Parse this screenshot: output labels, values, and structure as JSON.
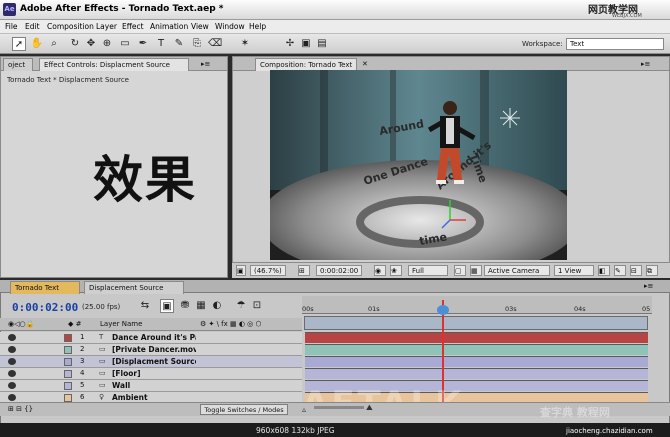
{
  "window": {
    "title": "Adobe After Effects - Tornado Text.aep *",
    "app_icon": "Ae"
  },
  "watermark_top": {
    "text": "网页教学网",
    "sub": "WEBJX.COM"
  },
  "menu": [
    "File",
    "Edit",
    "Composition",
    "Layer",
    "Effect",
    "Animation",
    "View",
    "Window",
    "Help"
  ],
  "workspace": {
    "label": "Workspace:",
    "value": "Text"
  },
  "left_panel": {
    "tabs": [
      "oject",
      "Effect Controls: Displacment Source"
    ],
    "subtitle": "Tornado Text * Displacment Source",
    "overlay_text": "效果"
  },
  "comp_panel": {
    "tab": "Composition: Tornado Text",
    "footer": {
      "zoom": "(46.7%)",
      "timecode": "0:00:02:00",
      "resolution": "Full",
      "camera": "Active Camera",
      "views": "1 View"
    }
  },
  "timeline": {
    "tabs": [
      "Tornado Text",
      "Displacement Source"
    ],
    "timecode": "0:00:02:00",
    "fps": "(25.00 fps)",
    "ruler": [
      "00s",
      "01s",
      "03s",
      "04s",
      "05"
    ],
    "layer_header": "Layer Name",
    "layers": [
      {
        "num": "1",
        "type": "T",
        "name": "Dance Around it's Pa",
        "color": "#b84343"
      },
      {
        "num": "2",
        "type": "▭",
        "name": "[Private Dancer.mov",
        "color": "#8fc3b8"
      },
      {
        "num": "3",
        "type": "▭",
        "name": "[Displacment Source",
        "color": "#a9a9d6"
      },
      {
        "num": "4",
        "type": "▭",
        "name": "[Floor]",
        "color": "#b5b5d8"
      },
      {
        "num": "5",
        "type": "▭",
        "name": "Wall",
        "color": "#b5b5d8"
      },
      {
        "num": "6",
        "type": "♀",
        "name": "Ambient",
        "color": "#e8c49c"
      }
    ],
    "toggle_label": "Toggle Switches / Modes"
  },
  "statusbar": {
    "text": "960x608  132kb  JPEG"
  },
  "watermark_bottom": {
    "text": "查字典 教程网",
    "sub": "jiaocheng.chazidian.com",
    "ghost": "AETALK"
  }
}
